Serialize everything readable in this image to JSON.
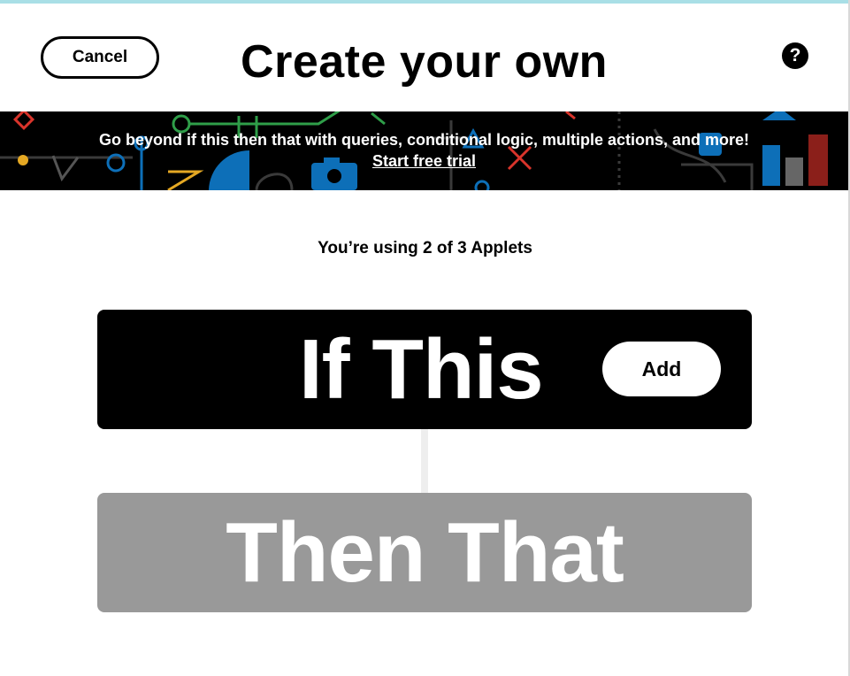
{
  "header": {
    "cancel_label": "Cancel",
    "title": "Create your own",
    "help_glyph": "?"
  },
  "promo": {
    "text": "Go beyond if this then that with queries, conditional logic, multiple actions, and more!",
    "link_label": "Start free trial"
  },
  "usage": {
    "text": "You’re using 2 of 3 Applets"
  },
  "builder": {
    "if_label": "If This",
    "add_label": "Add",
    "then_label": "Then That"
  },
  "colors": {
    "if_card": "#000000",
    "then_card": "#999999",
    "banner": "#000000",
    "accent_blue": "#0d6fb8",
    "accent_red": "#d9342b",
    "accent_yellow": "#e5a823",
    "accent_green": "#2f9e49"
  },
  "icons": [
    "help-icon",
    "camera-icon"
  ]
}
